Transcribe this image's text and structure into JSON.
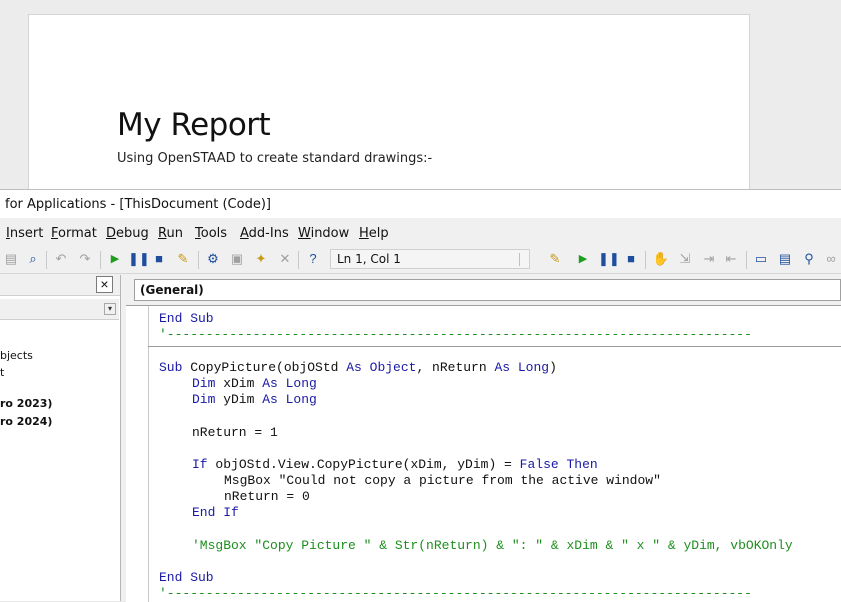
{
  "document": {
    "title": "My Report",
    "subtitle": "Using OpenSTAAD to create standard drawings:-"
  },
  "vbe": {
    "title": "for Applications - [ThisDocument (Code)]",
    "menu": [
      "Insert",
      "Format",
      "Debug",
      "Run",
      "Tools",
      "Add-Ins",
      "Window",
      "Help"
    ],
    "position": "Ln 1, Col 1",
    "toolbar_icons": [
      "paste-icon",
      "find-icon",
      "undo-icon",
      "redo-icon",
      "run-icon",
      "break-icon",
      "reset-icon",
      "design-mode-icon",
      "project-explorer-icon",
      "properties-icon",
      "object-browser-icon",
      "toolbox-icon",
      "help-icon"
    ],
    "explorer": {
      "close_label": "×",
      "items": [
        {
          "label": "bjects",
          "bold": false
        },
        {
          "label": "t",
          "bold": false
        },
        {
          "label": "ro 2023)",
          "bold": true
        },
        {
          "label": "ro 2024)",
          "bold": true
        }
      ]
    },
    "procedure_dropdown": "(General)",
    "code": {
      "end_sub_top": "End Sub",
      "separator_comment": "'---------------------------------------------------------------------------",
      "sub_kw": "Sub",
      "sub_name": " CopyPicture(objOStd ",
      "as1": "As Object",
      "sub_mid": ", nReturn ",
      "as2": "As Long",
      "sub_end": ")",
      "dim1_kw": "Dim",
      "dim1_var": " xDim ",
      "dim1_type": "As Long",
      "dim2_kw": "Dim",
      "dim2_var": " yDim ",
      "dim2_type": "As Long",
      "assign": "nReturn = 1",
      "if_kw": "If",
      "if_expr": " objOStd.View.CopyPicture(xDim, yDim) = ",
      "if_false": "False Then",
      "msgbox_line": "MsgBox \"Could not copy a picture from the active window\"",
      "assign_zero": "nReturn = 0",
      "end_if": "End If",
      "comment_line": "'MsgBox \"Copy Picture \" & Str(nReturn) & \": \" & xDim & \" x \" & yDim, vbOKOnly",
      "end_sub_bottom": "End Sub",
      "separator_bottom": "'---------------------------------------------------------------------------"
    }
  }
}
